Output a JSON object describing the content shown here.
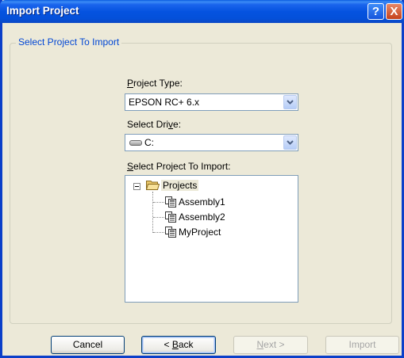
{
  "window": {
    "title": "Import Project",
    "help_glyph": "?",
    "close_glyph": "X"
  },
  "group": {
    "label": "Select Project To Import"
  },
  "project_type": {
    "label_accel": "P",
    "label_rest": "roject Type:",
    "value": "EPSON RC+ 6.x"
  },
  "drive": {
    "label_pre": "Select Dri",
    "label_accel": "v",
    "label_post": "e:",
    "value": "C:",
    "icon": "drive-icon"
  },
  "tree": {
    "label_accel": "S",
    "label_rest": "elect Project To Import:",
    "root": {
      "label": "Projects",
      "icon": "folder-open-icon",
      "expanded": true,
      "selected": true
    },
    "items": [
      {
        "label": "Assembly1",
        "icon": "project-icon"
      },
      {
        "label": "Assembly2",
        "icon": "project-icon"
      },
      {
        "label": "MyProject",
        "icon": "project-icon"
      }
    ]
  },
  "buttons": {
    "cancel": "Cancel",
    "back_glyph": "<",
    "back_accel": "B",
    "back_rest": "ack",
    "next_accel": "N",
    "next_rest": "ext",
    "next_glyph": ">",
    "import": "Import"
  },
  "colors": {
    "titlebar": "#0553e0",
    "group_label": "#0046d5",
    "dialog_bg": "#ece9d8"
  }
}
